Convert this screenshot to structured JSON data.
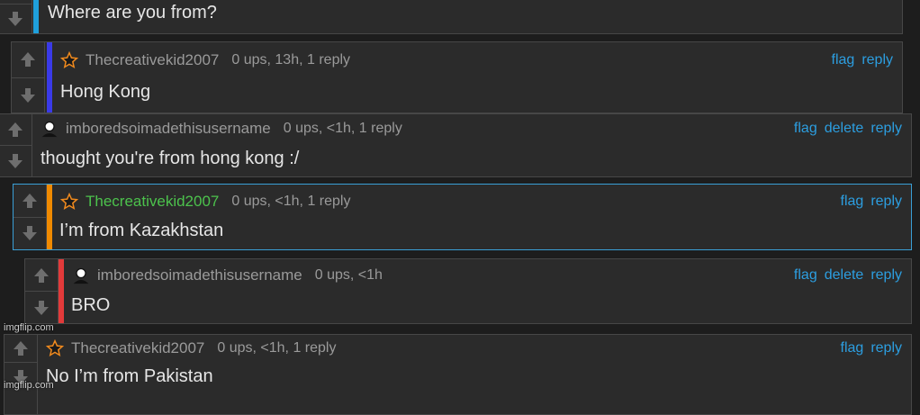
{
  "comments": [
    {
      "text": "Where are you from?",
      "bar_color": "#1fa0dc"
    },
    {
      "user": "Thecreativekid2007",
      "meta": "0 ups, 13h, 1 reply",
      "avatar": "star-icon",
      "bar_color": "#3a3ae8",
      "text": "Hong Kong",
      "actions": [
        "flag",
        "reply"
      ]
    },
    {
      "user": "imboredsoimadethisusername",
      "meta": "0 ups, <1h, 1 reply",
      "avatar": "person-icon",
      "bar_color": "",
      "text": "thought you're from hong kong :/",
      "actions": [
        "flag",
        "delete",
        "reply"
      ]
    },
    {
      "user": "Thecreativekid2007",
      "meta": "0 ups, <1h, 1 reply",
      "avatar": "star-icon",
      "bar_color": "#f08a00",
      "user_color": "#4cc24c",
      "text": "I’m from Kazakhstan",
      "actions": [
        "flag",
        "reply"
      ]
    },
    {
      "user": "imboredsoimadethisusername",
      "meta": "0 ups, <1h",
      "avatar": "person-icon",
      "bar_color": "#e23a3a",
      "text": "BRO",
      "actions": [
        "flag",
        "delete",
        "reply"
      ]
    },
    {
      "user": "Thecreativekid2007",
      "meta": "0 ups, <1h, 1 reply",
      "avatar": "star-icon",
      "bar_color": "",
      "text": "No I’m from Pakistan",
      "actions": [
        "flag",
        "reply"
      ]
    }
  ],
  "watermarks": [
    "imgflip.com",
    "imgflip.com"
  ],
  "colors": {
    "link": "#2c9ee0",
    "background": "#1d1d1d",
    "card": "#2b2b2b",
    "highlight_border": "#3a9fd6"
  }
}
